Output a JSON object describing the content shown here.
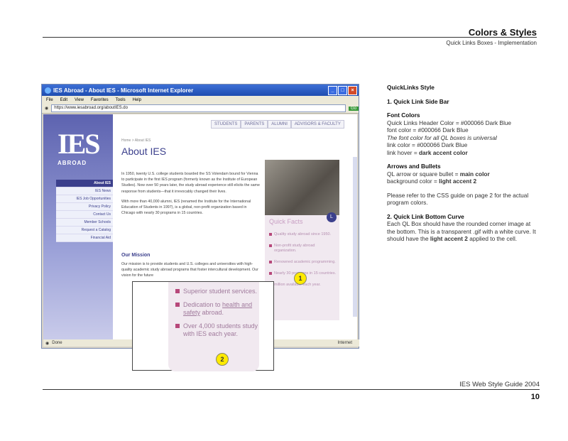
{
  "header": {
    "title": "Colors & Styles",
    "subtitle": "Quick Links Boxes - Implementation"
  },
  "browser": {
    "window_title": "IES Abroad - About IES - Microsoft Internet Explorer",
    "menu": [
      "File",
      "Edit",
      "View",
      "Favorites",
      "Tools",
      "Help"
    ],
    "address": "https://www.iesabroad.org/aboutIES.do",
    "go": "Go",
    "status_done": "Done",
    "status_zone": "Internet",
    "logo": "IES",
    "logo_sub": "ABROAD",
    "tabs": [
      "STUDENTS",
      "PARENTS",
      "ALUMNI",
      "ADVISORS & FACULTY"
    ],
    "sidenav": [
      "About IES",
      "IES News",
      "IES Job Opportunities",
      "Privacy Policy",
      "Contact Us",
      "Member Schools",
      "Request a Catalog",
      "Financial Aid"
    ],
    "breadcrumb": "Home > About IES",
    "page_title": "About IES",
    "body_p1": "In 1950, twenty U.S. college students boarded the SS Volendam bound for Vienna to participate in the first IES program (formerly known as the Institute of European Studies). Now over 50 years later, the study abroad experience still elicits the same response from students—that it irrevocably changed their lives.",
    "body_p2": "With more than 40,000 alumni, IES (renamed the Institute for the International Education of Students in 1997), is a global, non-profit organization based in Chicago with nearly 30 programs in 15 countries.",
    "mission_heading": "Our Mission",
    "mission_text": "Our mission is to provide students and U.S. colleges and universities with high-quality academic study abroad programs that foster intercultural development. Our vision for the future",
    "quick_facts_heading": "Quick Facts",
    "quick_facts": [
      "Quality study abroad since 1950.",
      "Non-profit study abroad organization.",
      "Renowned academic programming.",
      "Nearly 30 programs in 15 countries.",
      "million available each year."
    ]
  },
  "zoom": {
    "items": [
      {
        "text": "Superior student services.",
        "link": ""
      },
      {
        "text_pre": "Dedication to ",
        "link": "health and safety",
        "text_post": " abroad."
      },
      {
        "text": "Over 4,000 students study with IES each year.",
        "link": ""
      }
    ],
    "marker1": "1",
    "marker2": "2"
  },
  "right": {
    "heading": "QuickLinks Style",
    "sec1": "1. Quick Link Side Bar",
    "font_colors_hd": "Font Colors",
    "fc1": "Quick Links Header Color = #000066 Dark Blue",
    "fc2": "font color = #000066 Dark Blue",
    "fc3": "The font color for all QL boxes is universal",
    "fc4": "link color = #000066 Dark Blue",
    "fc5_pre": "link hover = ",
    "fc5_b": "dark accent color",
    "arrows_hd": "Arrows and Bullets",
    "ab1_pre": "QL arrow or square bullet = ",
    "ab1_b": "main color",
    "ab2_pre": "background color = ",
    "ab2_b": "light accent 2",
    "refer": "Please refer to the CSS guide on page 2 for the actual program colors.",
    "sec2": "2. Quick Link Bottom Curve",
    "curve_pre": "Each QL Box should have the rounded corner image at the bottom. This is a transparent .gif with a white curve. It should have the ",
    "curve_b": "light accent 2",
    "curve_post": " applied to the cell."
  },
  "footer": {
    "guide": "IES Web Style Guide 2004",
    "page": "10"
  }
}
